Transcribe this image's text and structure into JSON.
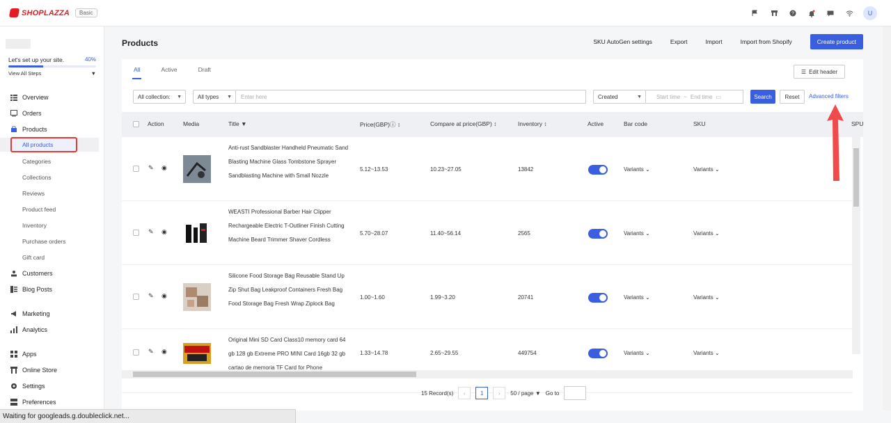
{
  "app": {
    "brand": "SHOPLAZZA",
    "plan": "Basic",
    "user_initial": "U",
    "accent": "#3a5ee0",
    "brand_color": "#e31b23"
  },
  "top_icons": [
    "flag-icon",
    "store-icon",
    "help-icon",
    "bell-icon",
    "message-icon",
    "wifi-icon"
  ],
  "setup": {
    "label": "Let's set up your site.",
    "percent": "40%",
    "progress": 0.4,
    "view_all": "View All Steps"
  },
  "sidebar": {
    "overview": "Overview",
    "orders": "Orders",
    "products": "Products",
    "all_products": "All products",
    "categories": "Categories",
    "collections": "Collections",
    "reviews": "Reviews",
    "product_feed": "Product feed",
    "inventory": "Inventory",
    "purchase_orders": "Purchase orders",
    "gift_card": "Gift card",
    "customers": "Customers",
    "blog_posts": "Blog Posts",
    "marketing": "Marketing",
    "analytics": "Analytics",
    "apps": "Apps",
    "online_store": "Online Store",
    "settings": "Settings",
    "preferences": "Preferences"
  },
  "header": {
    "title": "Products",
    "sku_autogen": "SKU AutoGen settings",
    "export": "Export",
    "import": "Import",
    "import_shopify": "Import from Shopify",
    "create": "Create product"
  },
  "tabs": [
    "All",
    "Active",
    "Draft"
  ],
  "edit_header": "Edit header",
  "filters": {
    "collections": "All collection:",
    "types": "All types",
    "search_placeholder": "Enter here",
    "date_field": "Created",
    "start_time": "Start time",
    "range_sep": "~",
    "end_time": "End time",
    "search": "Search",
    "reset": "Reset",
    "advanced": "Advanced filters"
  },
  "columns": {
    "action": "Action",
    "media": "Media",
    "title": "Title",
    "price": "Price(GBP)",
    "compare": "Compare at price(GBP)",
    "inventory": "Inventory",
    "active": "Active",
    "barcode": "Bar code",
    "sku": "SKU",
    "spu": "SPU"
  },
  "rows": [
    {
      "title": "Anti-rust Sandblaster Handheld Pneumatic Sand Blasting Machine Glass Tombstone Sprayer Sandblasting Machine with Small Nozzle",
      "price": "5.12~13.53",
      "compare": "10.23~27.05",
      "inventory": "13842",
      "barcode": "Variants",
      "sku": "Variants"
    },
    {
      "title": "WEASTI Professional Barber Hair Clipper Rechargeable Electric T-Outliner Finish Cutting Machine Beard Trimmer Shaver Cordless",
      "price": "5.70~28.07",
      "compare": "11.40~56.14",
      "inventory": "2565",
      "barcode": "Variants",
      "sku": "Variants"
    },
    {
      "title": "Silicone Food Storage Bag Reusable Stand Up Zip Shut Bag Leakproof Containers Fresh Bag Food Storage Bag Fresh Wrap Ziplock Bag",
      "price": "1.00~1.60",
      "compare": "1.99~3.20",
      "inventory": "20741",
      "barcode": "Variants",
      "sku": "Variants"
    },
    {
      "title": "Original Mini SD Card Class10 memory card 64 gb 128 gb Extreme PRO MINI Card 16gb 32 gb cartao de memoria TF Card for Phone",
      "price": "1.33~14.78",
      "compare": "2.65~29.55",
      "inventory": "449754",
      "barcode": "Variants",
      "sku": "Variants"
    }
  ],
  "pagination": {
    "records": "15 Record(s)",
    "page": "1",
    "per_page": "50 / page",
    "goto": "Go to"
  },
  "status_bar": "Waiting for googleads.g.doubleclick.net..."
}
